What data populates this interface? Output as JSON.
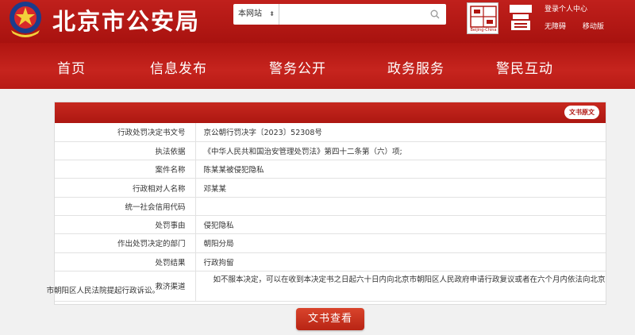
{
  "header": {
    "site_title": "北京市公安局",
    "search": {
      "scope": "本网站",
      "placeholder": ""
    },
    "logo_text": "Beijing-China",
    "top_links": {
      "login": "登录个人中心",
      "accessibility": "无障碍",
      "mobile": "移动版"
    }
  },
  "nav": {
    "items": [
      "首页",
      "信息发布",
      "警务公开",
      "政务服务",
      "警民互动"
    ]
  },
  "panel": {
    "badge": "文书原文",
    "rows": [
      {
        "label": "行政处罚决定书文号",
        "value": "京公朝行罚决字〔2023〕52308号"
      },
      {
        "label": "执法依据",
        "value": "《中华人民共和国治安管理处罚法》第四十二条第（六）项;"
      },
      {
        "label": "案件名称",
        "value": "陈某某被侵犯隐私"
      },
      {
        "label": "行政相对人名称",
        "value": "邓某某"
      },
      {
        "label": "统一社会信用代码",
        "value": ""
      },
      {
        "label": "处罚事由",
        "value": "侵犯隐私"
      },
      {
        "label": "作出处罚决定的部门",
        "value": "朝阳分局"
      },
      {
        "label": "处罚结果",
        "value": "行政拘留"
      }
    ],
    "remedy": {
      "label": "救济渠道",
      "value": "如不服本决定，可以在收到本决定书之日起六十日内向北京市朝阳区人民政府申请行政复议或者在六个月内依法向北京市朝阳区人民法院提起行政诉讼。"
    }
  },
  "view_button": "文书查看",
  "colors": {
    "brand_red": "#b81a15",
    "background": "#f1f1f1"
  }
}
